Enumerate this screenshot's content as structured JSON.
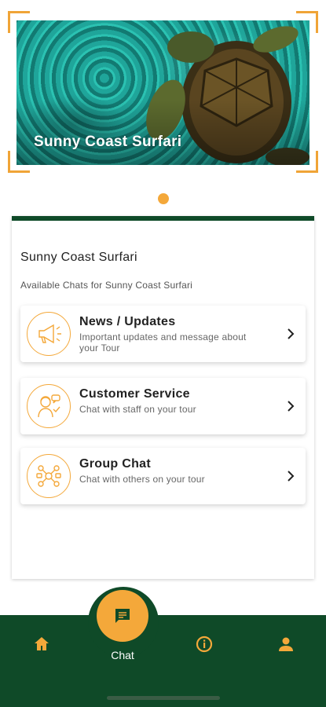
{
  "hero": {
    "title": "Sunny Coast Surfari"
  },
  "panel": {
    "title": "Sunny Coast Surfari",
    "subtitle": "Available Chats for Sunny Coast Surfari"
  },
  "chats": [
    {
      "title": "News / Updates",
      "description": "Important updates and message about your Tour",
      "icon": "megaphone-icon"
    },
    {
      "title": "Customer Service",
      "description": "Chat with staff on your tour",
      "icon": "support-agent-icon"
    },
    {
      "title": "Group Chat",
      "description": "Chat with others on your tour",
      "icon": "group-network-icon"
    }
  ],
  "nav": {
    "chat_label": "Chat",
    "items": [
      "home-icon",
      "chat-icon",
      "info-icon",
      "profile-icon"
    ]
  },
  "colors": {
    "accent": "#f4a83a",
    "brand_green": "#0f4a28"
  }
}
